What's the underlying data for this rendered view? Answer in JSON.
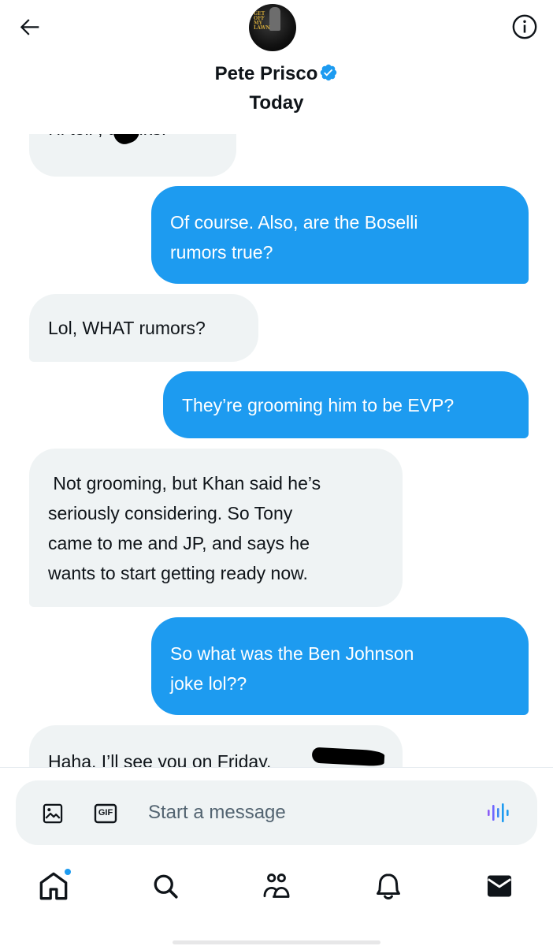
{
  "header": {
    "contact_name": "Pete Prisco",
    "date_label": "Today",
    "avatar_poster_text": "GET OFF MY LAWN"
  },
  "messages": [
    {
      "id": "m0",
      "direction": "received",
      "text": "I'll tell , thanks.",
      "partially_visible": true,
      "has_redaction": true
    },
    {
      "id": "m1",
      "direction": "sent",
      "lines": [
        "Of course. Also, are the Boselli",
        "rumors true?"
      ]
    },
    {
      "id": "m2",
      "direction": "received",
      "lines": [
        "Lol, WHAT rumors?"
      ]
    },
    {
      "id": "m3",
      "direction": "sent",
      "lines": [
        "They’re grooming him to be EVP?"
      ]
    },
    {
      "id": "m4",
      "direction": "received",
      "lines": [
        " Not grooming, but Khan said he’s",
        "seriously considering. So Tony",
        "came to me and JP, and says he",
        "wants to start getting ready now."
      ]
    },
    {
      "id": "m5",
      "direction": "sent",
      "lines": [
        "So what was the Ben Johnson",
        "joke lol??"
      ]
    },
    {
      "id": "m6",
      "direction": "received",
      "text": "Haha. I’ll see you on Friday.",
      "partially_visible": true,
      "has_redaction": true
    }
  ],
  "composer": {
    "placeholder": "Start a message",
    "value": "",
    "gif_label": "GIF"
  },
  "nav": {
    "items": [
      "home-icon",
      "search-icon",
      "communities-icon",
      "notifications-icon",
      "messages-icon"
    ],
    "home_has_notification_dot": true
  },
  "colors": {
    "sent_bubble": "#1d9bf0",
    "received_bubble": "#eff3f4",
    "verified_badge": "#1d9bf0",
    "text_primary": "#0f1419",
    "text_secondary": "#536471"
  }
}
